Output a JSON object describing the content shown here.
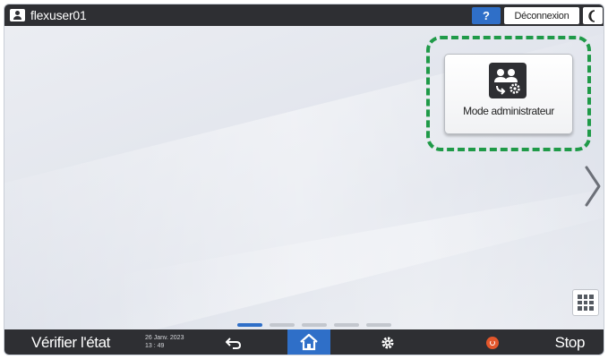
{
  "header": {
    "username": "flexuser01",
    "help_label": "?",
    "logout_label": "Déconnexion"
  },
  "main": {
    "admin_button_label": "Mode administrateur",
    "page_count": 5,
    "current_page": 1
  },
  "footer": {
    "status_label": "Vérifier l'état",
    "date": "26 Janv. 2023",
    "time": "13 : 49",
    "stop_label": "Stop"
  },
  "icons": {
    "user": "user-icon",
    "sleep": "moon-icon",
    "admin": "admin-users-gear-icon",
    "next": "chevron-right-icon",
    "apps": "grid-icon",
    "back": "back-arrow-icon",
    "home": "home-icon",
    "settings": "gear-icon",
    "stop": "stop-icon"
  },
  "colors": {
    "bar": "#2e2f33",
    "accent": "#2f6fc8",
    "highlight": "#1f9a48",
    "stop": "#e2562b"
  }
}
